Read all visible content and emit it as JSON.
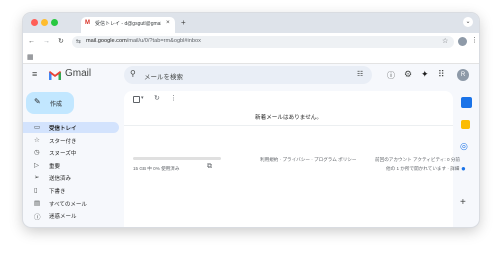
{
  "browser": {
    "tab_title": "受信トレイ - d@gsgutl@gmail.c",
    "new_tab": "+",
    "url_host": "mail.google.com",
    "url_path": "/mail/u/0/?tab=rm&ogbl#inbox"
  },
  "app": {
    "name": "Gmail"
  },
  "search": {
    "placeholder": "メールを検索"
  },
  "compose": {
    "label": "作成"
  },
  "sidebar": {
    "items": [
      {
        "label": "受信トレイ",
        "icon": "inbox-icon",
        "glyph": "▭",
        "active": true
      },
      {
        "label": "スター付き",
        "icon": "star-icon",
        "glyph": "☆"
      },
      {
        "label": "スヌーズ中",
        "icon": "clock-icon",
        "glyph": "◷"
      },
      {
        "label": "重要",
        "icon": "important-icon",
        "glyph": "▷"
      },
      {
        "label": "送信済み",
        "icon": "send-icon",
        "glyph": "➢"
      },
      {
        "label": "下書き",
        "icon": "draft-icon",
        "glyph": "▯"
      },
      {
        "label": "すべてのメール",
        "icon": "all-mail-icon",
        "glyph": "▤"
      },
      {
        "label": "迷惑メール",
        "icon": "spam-icon",
        "glyph": "ⓘ"
      }
    ]
  },
  "main": {
    "empty_message": "新着メールはありません。",
    "storage": "15 GB 中 0% 使用済み",
    "storage_fraction": 0.0,
    "footer_links": "利用規約 · プライバシー · プログラム ポリシー",
    "last_activity": "前回のアカウント アクティビティ: 0 分前",
    "other_location": "他の 1 か所で開かれています · 詳細"
  },
  "account": {
    "avatar_letter": "R"
  },
  "colors": {
    "accent": "#0b57d0",
    "compose_bg": "#c2e7ff",
    "active_nav": "#d3e3fd",
    "bg": "#f6f8fc"
  }
}
